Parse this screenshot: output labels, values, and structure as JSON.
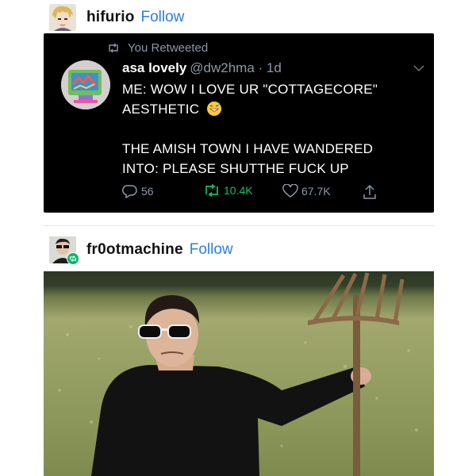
{
  "posts": [
    {
      "username": "hifurio",
      "follow_label": "Follow"
    },
    {
      "username": "fr0otmachine",
      "follow_label": "Follow"
    }
  ],
  "tweet": {
    "retweet_label": "You Retweeted",
    "display_name": "asa lovely",
    "handle_time": "@dw2hma · 1d",
    "body_line1": "ME: WOW I LOVE UR \"COTTAGECORE\"",
    "body_line2": "AESTHETIC",
    "body_line3": "THE AMISH TOWN I HAVE WANDERED",
    "body_line4": "INTO: PLEASE SHUTTHE FUCK UP",
    "replies": "56",
    "retweets": "10.4K",
    "likes": "67.7K",
    "emoji": "grinning-sweat-emoji"
  },
  "colors": {
    "follow": "#2d7fe0",
    "retweeted": "#17bf63",
    "tweet_bg": "#000000",
    "muted": "#8b98a5"
  },
  "icons": [
    "retweet-icon",
    "reply-icon",
    "like-icon",
    "share-icon",
    "chevron-down-icon",
    "reblog-badge-icon"
  ]
}
